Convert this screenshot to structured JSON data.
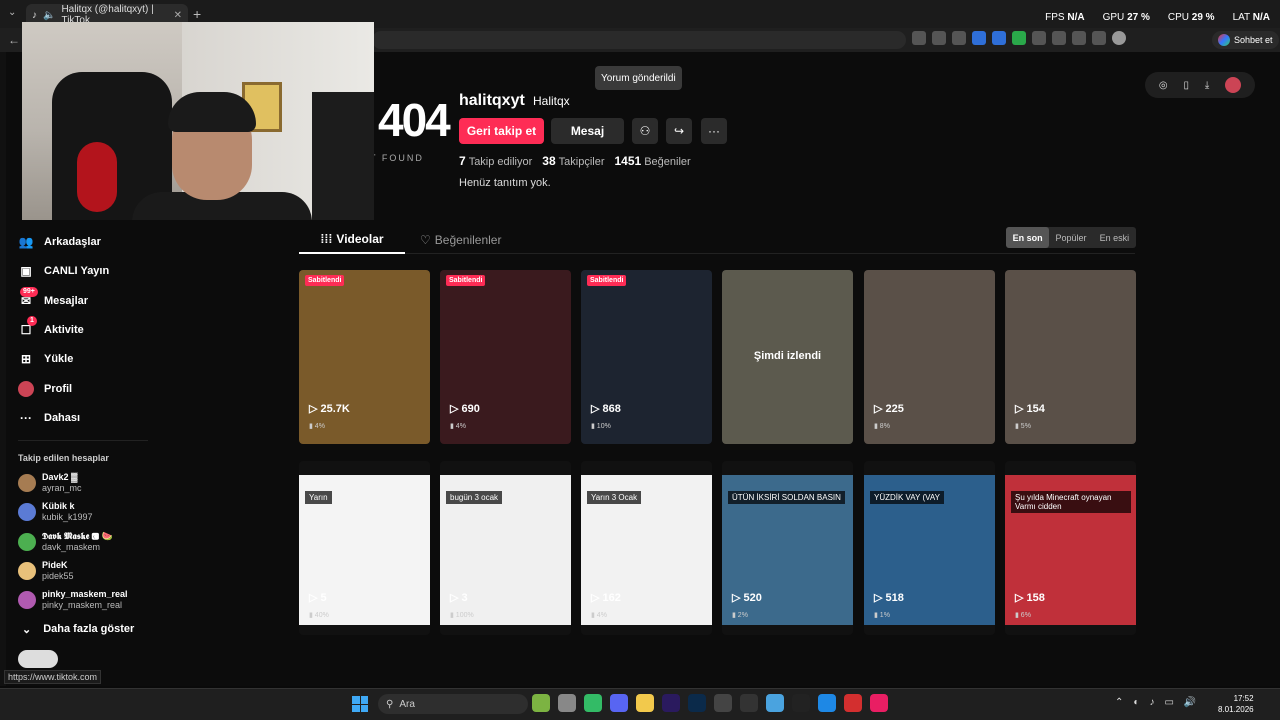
{
  "browser": {
    "tab_title": "Halitqx (@halitqxyt) | TikTok",
    "tab_close": "✕",
    "new_tab": "+",
    "chat_button": "Sohbet et",
    "status_url": "https://www.tiktok.com"
  },
  "overlay": {
    "fps_label": "FPS",
    "fps_value": "N/A",
    "gpu_label": "GPU",
    "gpu_value": "27 %",
    "cpu_label": "CPU",
    "cpu_value": "29 %",
    "lat_label": "LAT",
    "lat_value": "N/A"
  },
  "page_error": {
    "code": "404",
    "text": "T FOUND"
  },
  "toast": "Yorum gönderildi",
  "profile": {
    "username": "halitqxyt",
    "nickname": "Halitqx",
    "follow_back_button": "Geri takip et",
    "message_button": "Mesaj",
    "following_count": "7",
    "following_label": "Takip ediliyor",
    "followers_count": "38",
    "followers_label": "Takipçiler",
    "likes_count": "1451",
    "likes_label": "Beğeniler",
    "bio": "Henüz tanıtım yok."
  },
  "sidebar": {
    "items": [
      {
        "label": "Arkadaşlar",
        "icon": "friends-icon"
      },
      {
        "label": "CANLI Yayın",
        "icon": "live-icon"
      },
      {
        "label": "Mesajlar",
        "icon": "messages-icon",
        "badge": "99+"
      },
      {
        "label": "Aktivite",
        "icon": "activity-icon",
        "badge": "1"
      },
      {
        "label": "Yükle",
        "icon": "upload-icon"
      },
      {
        "label": "Profil",
        "icon": "profile-icon"
      },
      {
        "label": "Dahası",
        "icon": "more-icon"
      }
    ],
    "following_title": "Takip edilen hesaplar",
    "accounts": [
      {
        "name": "Davk2 ▓",
        "handle": "ayran_mc",
        "color": "#a67c52"
      },
      {
        "name": "Kübik k",
        "handle": "kubik_k1997",
        "color": "#5b7bd5"
      },
      {
        "name": "𝕯𝖆𝖛𝖐 𝕸𝖆𝖘𝖐𝖊 🅲 🍉",
        "handle": "davk_maskem",
        "color": "#4caf50"
      },
      {
        "name": "PideK",
        "handle": "pidek55",
        "color": "#e8c07a"
      },
      {
        "name": "pinky_maskem_real",
        "handle": "pinky_maskem_real",
        "color": "#b05ab0"
      }
    ],
    "show_more": "Daha fazla göster"
  },
  "tabs": {
    "videos": "Videolar",
    "liked": "Beğenilenler"
  },
  "sort": {
    "latest": "En son",
    "popular": "Popüler",
    "oldest": "En eski"
  },
  "videos": [
    {
      "views": "25.7K",
      "pct": "4%",
      "pinned": "Sabitlendi",
      "color": "#7a5a2a"
    },
    {
      "views": "690",
      "pct": "4%",
      "pinned": "Sabitlendi",
      "color": "#3a1a1e"
    },
    {
      "views": "868",
      "pct": "10%",
      "pinned": "Sabitlendi",
      "color": "#1d2430"
    },
    {
      "views": "",
      "pct": "",
      "now": "Şimdi izlendi",
      "color": "#5c5a4e"
    },
    {
      "views": "225",
      "pct": "8%",
      "color": "#5a5048"
    },
    {
      "views": "154",
      "pct": "5%",
      "color": "#5a5048"
    },
    {
      "views": "5",
      "pct": "40%",
      "caption": "Yarın",
      "color": "#f4f4f4"
    },
    {
      "views": "3",
      "pct": "100%",
      "caption": "bugün 3 ocak",
      "color": "#f0f0f0"
    },
    {
      "views": "162",
      "pct": "4%",
      "caption": "Yarın 3 Ocak",
      "color": "#f2f2f2"
    },
    {
      "views": "520",
      "pct": "2%",
      "caption": "ÜTÜN İKSİRİ SOLDAN BASIN",
      "color": "#3c6a8c"
    },
    {
      "views": "518",
      "pct": "1%",
      "caption": "YÜZDİK VAY (VAY",
      "color": "#2c5f8c"
    },
    {
      "views": "158",
      "pct": "6%",
      "caption": "Şu yılda Minecraft oynayan Varmı cidden",
      "color": "#c0303a"
    }
  ],
  "taskbar": {
    "search": "Ara",
    "time": "17:52",
    "date": "8.01.2026"
  }
}
